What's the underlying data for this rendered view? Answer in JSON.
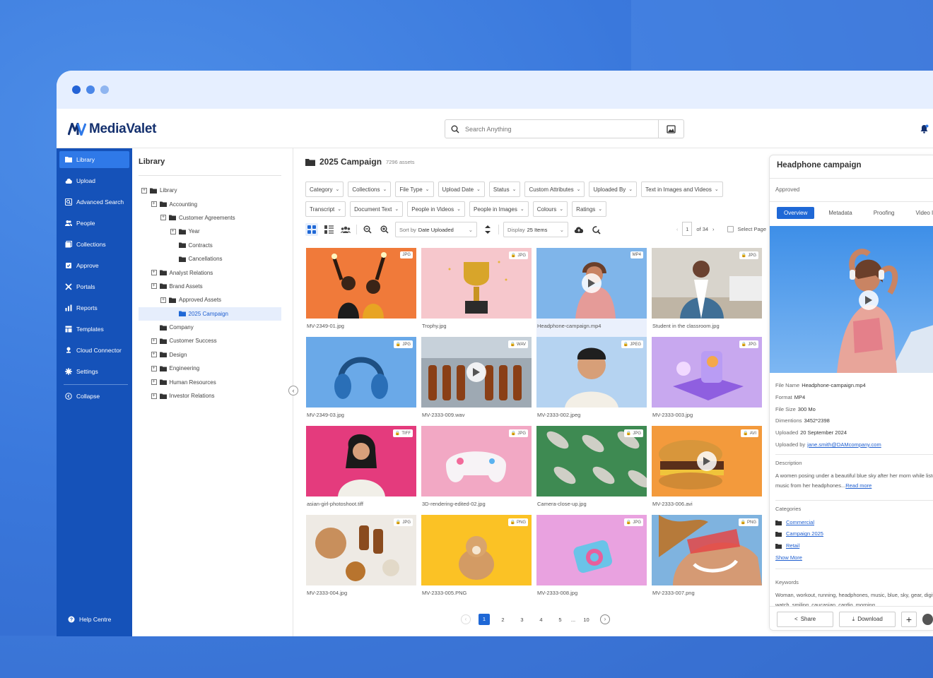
{
  "app": {
    "brand": "MediaValet"
  },
  "search": {
    "placeholder": "Search Anything"
  },
  "sidebar": {
    "items": [
      {
        "label": "Library",
        "icon": "folder-icon",
        "active": true
      },
      {
        "label": "Upload",
        "icon": "cloud-upload-icon"
      },
      {
        "label": "Advanced Search",
        "icon": "advanced-search-icon"
      },
      {
        "label": "People",
        "icon": "people-icon"
      },
      {
        "label": "Collections",
        "icon": "collections-icon"
      },
      {
        "label": "Approve",
        "icon": "approve-icon"
      },
      {
        "label": "Portals",
        "icon": "portals-icon"
      },
      {
        "label": "Reports",
        "icon": "reports-icon"
      },
      {
        "label": "Templates",
        "icon": "templates-icon"
      },
      {
        "label": "Cloud Connector",
        "icon": "cloud-connector-icon"
      },
      {
        "label": "Settings",
        "icon": "gear-icon"
      }
    ],
    "collapse": "Collapse",
    "help": "Help Centre"
  },
  "library": {
    "title": "Library",
    "tree": [
      {
        "label": "Library",
        "level": 0,
        "toggle": "+"
      },
      {
        "label": "Accounting",
        "level": 1,
        "toggle": "+"
      },
      {
        "label": "Customer Agreements",
        "level": 2,
        "toggle": "+"
      },
      {
        "label": "Year",
        "level": 3,
        "toggle": "+"
      },
      {
        "label": "Contracts",
        "level": 3,
        "toggle": ""
      },
      {
        "label": "Cancellations",
        "level": 3,
        "toggle": ""
      },
      {
        "label": "Analyst Relations",
        "level": 1,
        "toggle": "+"
      },
      {
        "label": "Brand Assets",
        "level": 1,
        "toggle": "+"
      },
      {
        "label": "Approved Assets",
        "level": 2,
        "toggle": "+"
      },
      {
        "label": "2025 Campaign",
        "level": 3,
        "toggle": "",
        "selected": true
      },
      {
        "label": "Company",
        "level": 1,
        "toggle": ""
      },
      {
        "label": "Customer Success",
        "level": 1,
        "toggle": "+"
      },
      {
        "label": "Design",
        "level": 1,
        "toggle": "+"
      },
      {
        "label": "Engineering",
        "level": 1,
        "toggle": "+"
      },
      {
        "label": "Human Resources",
        "level": 1,
        "toggle": "+"
      },
      {
        "label": "Investor Relations",
        "level": 1,
        "toggle": "+"
      }
    ]
  },
  "main": {
    "title": "2025 Campaign",
    "count": "7296 assets",
    "filters": [
      "Category",
      "Collections",
      "File Type",
      "Upload Date",
      "Status",
      "Custom Attributes",
      "Uploaded By",
      "Text in Images and Videos",
      "Transcript",
      "Document Text",
      "People in Videos",
      "People in Images",
      "Colours",
      "Ratings"
    ],
    "sort_prefix": "Sort by",
    "sort_value": "Date Uploaded",
    "display_prefix": "Display",
    "display_value": "25 Items",
    "page_current": "1",
    "page_of": "of 34",
    "select_page": "Select Page",
    "assets": [
      {
        "name": "MV-2349-01.jpg",
        "type": "JPG",
        "locked": false,
        "video": false
      },
      {
        "name": "Trophy.jpg",
        "type": "JPG",
        "locked": true,
        "video": false
      },
      {
        "name": "Headphone-campaign.mp4",
        "type": "MP4",
        "locked": false,
        "video": true,
        "selected": true
      },
      {
        "name": "Student in the classroom.jpg",
        "type": "JPG",
        "locked": true,
        "video": false
      },
      {
        "name": "MV-2349-03.jpg",
        "type": "JPG",
        "locked": true,
        "video": false
      },
      {
        "name": "MV-2333-009.wav",
        "type": "WAV",
        "locked": true,
        "video": true
      },
      {
        "name": "MV-2333-002.jpeg",
        "type": "JPEG",
        "locked": true,
        "video": false
      },
      {
        "name": "MV-2333-003.jpg",
        "type": "JPG",
        "locked": true,
        "video": false
      },
      {
        "name": "asian-girl-photoshoot.tiff",
        "type": "TIFF",
        "locked": true,
        "video": false
      },
      {
        "name": "3D-rendering-edited-02.jpg",
        "type": "JPG",
        "locked": true,
        "video": false
      },
      {
        "name": "Camera-close-up.jpg",
        "type": "JPG",
        "locked": true,
        "video": false
      },
      {
        "name": "MV-2333-006.avi",
        "type": "AVI",
        "locked": true,
        "video": true
      },
      {
        "name": "MV-2333-004.jpg",
        "type": "JPG",
        "locked": true,
        "video": false
      },
      {
        "name": "MV-2333-005.PNG",
        "type": "PNG",
        "locked": true,
        "video": false
      },
      {
        "name": "MV-2333-008.jpg",
        "type": "JPG",
        "locked": true,
        "video": false
      },
      {
        "name": "MV-2333-007.png",
        "type": "PNG",
        "locked": true,
        "video": false
      }
    ],
    "pages": [
      "1",
      "2",
      "3",
      "4",
      "5",
      "...",
      "10"
    ]
  },
  "panel": {
    "title": "Headphone campaign",
    "status": "Approved",
    "tabs": [
      "Overview",
      "Metadata",
      "Proofing",
      "Video In"
    ],
    "file_name_label": "File Name",
    "file_name": "Headphone-campaign.mp4",
    "format_label": "Format",
    "format": "MP4",
    "size_label": "File Size",
    "size": "300 Mo",
    "dim_label": "Dimentions",
    "dim": "3452*2398",
    "uploaded_label": "Uploaded",
    "uploaded": "20 September 2024",
    "uploaded_by_label": "Uploaded by",
    "uploaded_by": "jane.smith@DAMcompany.com",
    "description_label": "Description",
    "description": "A women posing under a beautiful blue sky after her morn while listening to music from her headphones...",
    "read_more": "Read more",
    "categories_label": "Categories",
    "categories": [
      "Commercial",
      "Campaign 2025",
      "Retail"
    ],
    "show_more": "Show More",
    "keywords_label": "Keywords",
    "keywords": "Woman, workout, running, headphones, music, blue, sky, gear, digital watch, smiling, caucasian, cardio, morning",
    "share": "Share",
    "download": "Download"
  },
  "colors": {
    "brand_blue": "#1552b9",
    "accent": "#1f68d6",
    "dot1": "#2463d6",
    "dot2": "#4b87e8",
    "dot3": "#8fb5f0"
  }
}
